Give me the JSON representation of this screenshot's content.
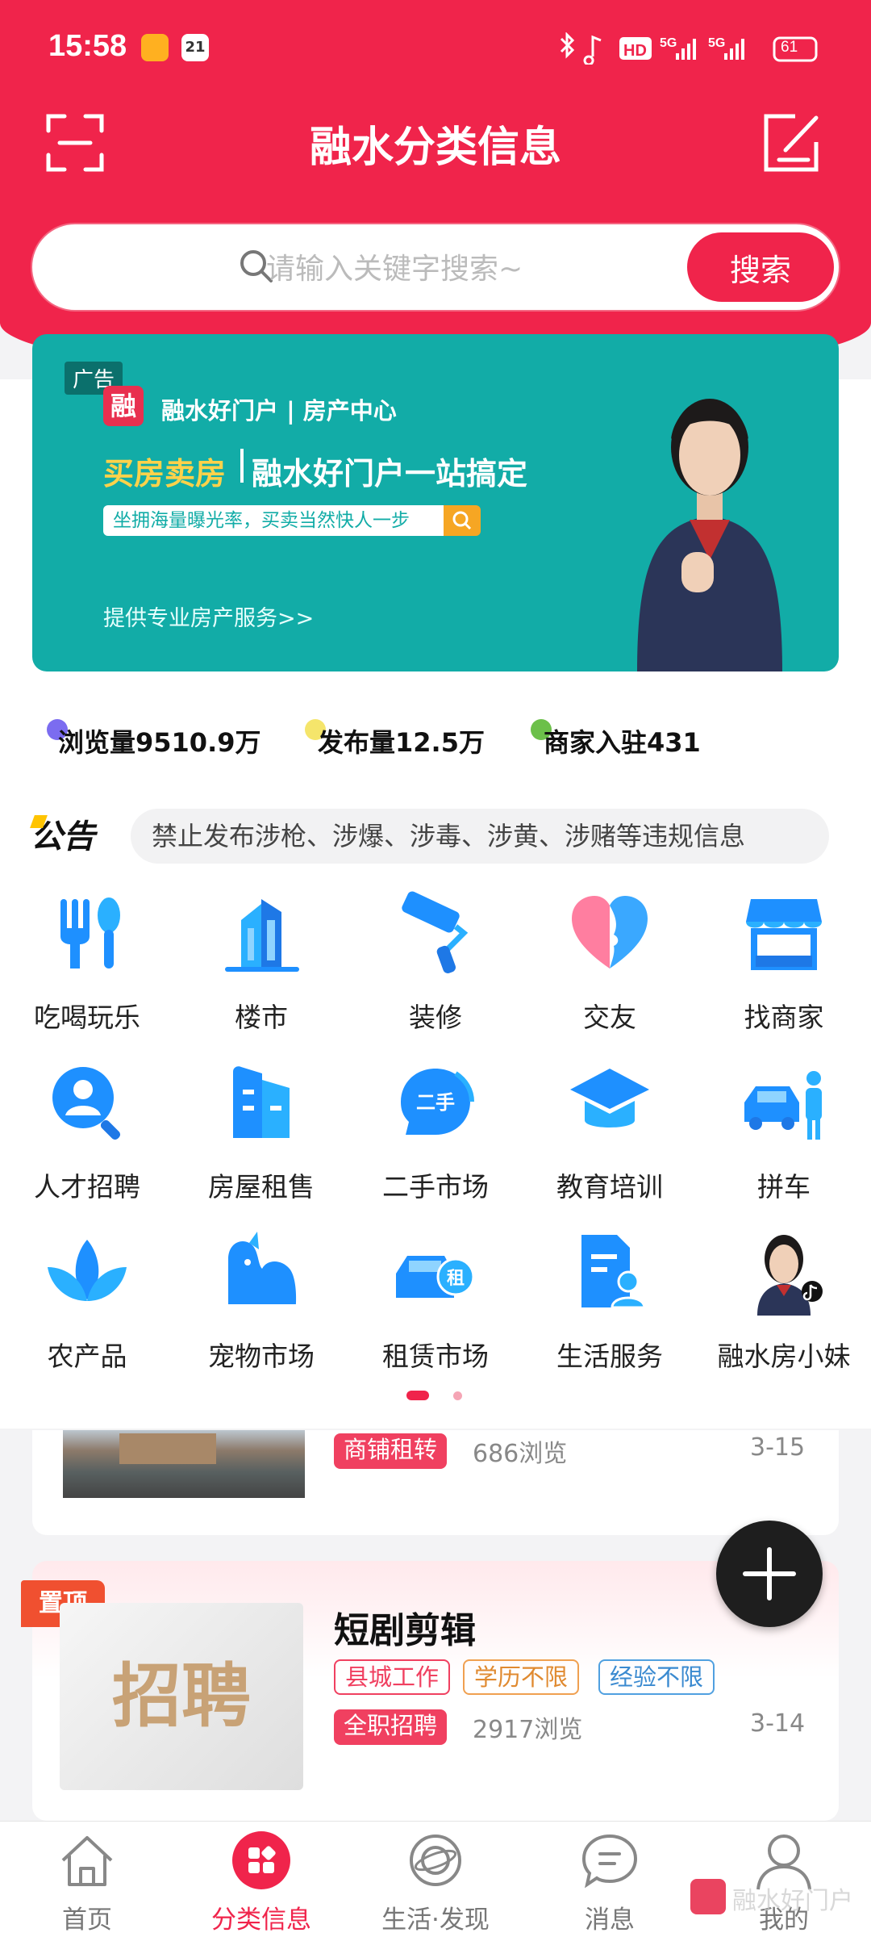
{
  "status_bar": {
    "time": "15:58",
    "notif_badge": "21",
    "network": "HD",
    "gen1": "5G",
    "gen2": "5G",
    "battery": "61"
  },
  "header": {
    "title": "融水分类信息",
    "scan_icon": "scan-icon",
    "edit_icon": "edit-icon"
  },
  "search": {
    "placeholder": "请输入关键字搜索~",
    "button": "搜索"
  },
  "banner": {
    "ad_label": "广告",
    "logo_char": "融",
    "brand": "融水好门户 | 房产中心",
    "headline_a": "买房卖房",
    "headline_b": "融水好门户一站搞定",
    "sub": "坐拥海量曝光率，买卖当然快人一步",
    "link": "提供专业房产服务>>"
  },
  "stats": [
    {
      "text": "浏览量9510.9万",
      "color": "#7b6cf0"
    },
    {
      "text": "发布量12.5万",
      "color": "#f5e56b"
    },
    {
      "text": "商家入驻431",
      "color": "#6cc04a"
    }
  ],
  "notice": {
    "label": "公告",
    "text": "禁止发布涉枪、涉爆、涉毒、涉黄、涉赌等违规信息"
  },
  "categories": [
    {
      "label": "吃喝玩乐",
      "icon": "fork-spoon-icon"
    },
    {
      "label": "楼市",
      "icon": "building-icon"
    },
    {
      "label": "装修",
      "icon": "paint-roller-icon"
    },
    {
      "label": "交友",
      "icon": "heart-face-icon"
    },
    {
      "label": "找商家",
      "icon": "shop-icon"
    },
    {
      "label": "人才招聘",
      "icon": "person-search-icon"
    },
    {
      "label": "房屋租售",
      "icon": "house-doc-icon"
    },
    {
      "label": "二手市场",
      "icon": "second-hand-icon"
    },
    {
      "label": "教育培训",
      "icon": "graduation-cap-icon"
    },
    {
      "label": "拼车",
      "icon": "carpool-icon"
    },
    {
      "label": "农产品",
      "icon": "leaf-icon"
    },
    {
      "label": "宠物市场",
      "icon": "pet-icon"
    },
    {
      "label": "租赁市场",
      "icon": "rent-car-icon"
    },
    {
      "label": "生活服务",
      "icon": "service-doc-icon"
    },
    {
      "label": "融水房小妹",
      "icon": "avatar-icon"
    }
  ],
  "listing1": {
    "tag": "商铺租转",
    "views": "686浏览",
    "date": "3-15"
  },
  "listing2": {
    "pin": "置顶",
    "thumb_text": "招聘",
    "title": "短剧剪辑",
    "tags": [
      "县城工作",
      "学历不限",
      "经验不限"
    ],
    "category_tag": "全职招聘",
    "views": "2917浏览",
    "date": "3-14"
  },
  "fab": {
    "icon": "plus-icon"
  },
  "nav": [
    {
      "label": "首页",
      "icon": "home-icon"
    },
    {
      "label": "分类信息",
      "icon": "grid-icon"
    },
    {
      "label": "生活·发现",
      "icon": "planet-icon"
    },
    {
      "label": "消息",
      "icon": "chat-icon"
    },
    {
      "label": "我的",
      "icon": "user-icon"
    }
  ],
  "watermark": "融水好门户"
}
